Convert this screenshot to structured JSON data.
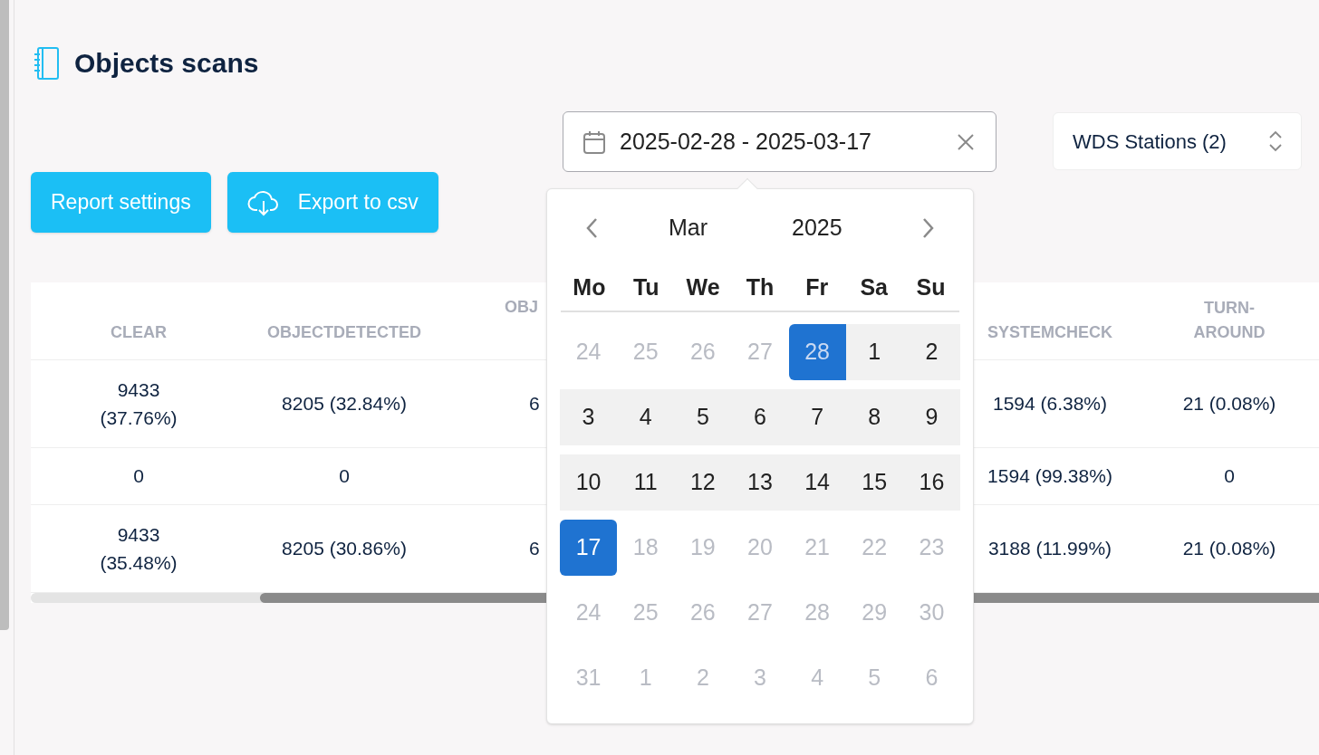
{
  "page_title": "Objects scans",
  "date_range": {
    "value": "2025-02-28 - 2025-03-17"
  },
  "station_select": {
    "value": "WDS Stations (2)"
  },
  "buttons": [
    {
      "kind": "plain",
      "label": "Report settings"
    },
    {
      "kind": "export",
      "label": "Export to csv"
    }
  ],
  "table": {
    "columns": [
      {
        "label": "CLEAR",
        "kind": "full"
      },
      {
        "label": "OBJECTDETECTED",
        "kind": "full"
      },
      {
        "label": "OBJ",
        "kind": "partial"
      },
      {
        "label": "SYSTEMCHECK",
        "kind": "full"
      },
      {
        "label": "TURN-AROUND",
        "kind": "full"
      }
    ],
    "rows": [
      [
        "9433 (37.76%)",
        "8205 (32.84%)",
        "6",
        "1594 (6.38%)",
        "21 (0.08%)"
      ],
      [
        "0",
        "0",
        "",
        "1594 (99.38%)",
        "0"
      ],
      [
        "9433 (35.48%)",
        "8205 (30.86%)",
        "6",
        "3188 (11.99%)",
        "21 (0.08%)"
      ]
    ]
  },
  "calendar": {
    "month": "Mar",
    "year": "2025",
    "weekdays": [
      "Mo",
      "Tu",
      "We",
      "Th",
      "Fr",
      "Sa",
      "Su"
    ],
    "weeks": [
      [
        {
          "label": "24",
          "muted": true,
          "selected": false,
          "in_range": false
        },
        {
          "label": "25",
          "muted": true,
          "selected": false,
          "in_range": false
        },
        {
          "label": "26",
          "muted": true,
          "selected": false,
          "in_range": false
        },
        {
          "label": "27",
          "muted": true,
          "selected": false,
          "in_range": false
        },
        {
          "label": "28",
          "muted": true,
          "selected": true,
          "in_range": true
        },
        {
          "label": "1",
          "muted": false,
          "selected": false,
          "in_range": true
        },
        {
          "label": "2",
          "muted": false,
          "selected": false,
          "in_range": true
        }
      ],
      [
        {
          "label": "3",
          "muted": false,
          "selected": false,
          "in_range": true
        },
        {
          "label": "4",
          "muted": false,
          "selected": false,
          "in_range": true
        },
        {
          "label": "5",
          "muted": false,
          "selected": false,
          "in_range": true
        },
        {
          "label": "6",
          "muted": false,
          "selected": false,
          "in_range": true
        },
        {
          "label": "7",
          "muted": false,
          "selected": false,
          "in_range": true
        },
        {
          "label": "8",
          "muted": false,
          "selected": false,
          "in_range": true
        },
        {
          "label": "9",
          "muted": false,
          "selected": false,
          "in_range": true
        }
      ],
      [
        {
          "label": "10",
          "muted": false,
          "selected": false,
          "in_range": true
        },
        {
          "label": "11",
          "muted": false,
          "selected": false,
          "in_range": true
        },
        {
          "label": "12",
          "muted": false,
          "selected": false,
          "in_range": true
        },
        {
          "label": "13",
          "muted": false,
          "selected": false,
          "in_range": true
        },
        {
          "label": "14",
          "muted": false,
          "selected": false,
          "in_range": true
        },
        {
          "label": "15",
          "muted": false,
          "selected": false,
          "in_range": true
        },
        {
          "label": "16",
          "muted": false,
          "selected": false,
          "in_range": true
        }
      ],
      [
        {
          "label": "17",
          "muted": false,
          "selected": true,
          "in_range": false
        },
        {
          "label": "18",
          "muted": true,
          "selected": false,
          "in_range": false
        },
        {
          "label": "19",
          "muted": true,
          "selected": false,
          "in_range": false
        },
        {
          "label": "20",
          "muted": true,
          "selected": false,
          "in_range": false
        },
        {
          "label": "21",
          "muted": true,
          "selected": false,
          "in_range": false
        },
        {
          "label": "22",
          "muted": true,
          "selected": false,
          "in_range": false
        },
        {
          "label": "23",
          "muted": true,
          "selected": false,
          "in_range": false
        }
      ],
      [
        {
          "label": "24",
          "muted": true,
          "selected": false,
          "in_range": false
        },
        {
          "label": "25",
          "muted": true,
          "selected": false,
          "in_range": false
        },
        {
          "label": "26",
          "muted": true,
          "selected": false,
          "in_range": false
        },
        {
          "label": "27",
          "muted": true,
          "selected": false,
          "in_range": false
        },
        {
          "label": "28",
          "muted": true,
          "selected": false,
          "in_range": false
        },
        {
          "label": "29",
          "muted": true,
          "selected": false,
          "in_range": false
        },
        {
          "label": "30",
          "muted": true,
          "selected": false,
          "in_range": false
        }
      ],
      [
        {
          "label": "31",
          "muted": true,
          "selected": false,
          "in_range": false
        },
        {
          "label": "1",
          "muted": true,
          "selected": false,
          "in_range": false
        },
        {
          "label": "2",
          "muted": true,
          "selected": false,
          "in_range": false
        },
        {
          "label": "3",
          "muted": true,
          "selected": false,
          "in_range": false
        },
        {
          "label": "4",
          "muted": true,
          "selected": false,
          "in_range": false
        },
        {
          "label": "5",
          "muted": true,
          "selected": false,
          "in_range": false
        },
        {
          "label": "6",
          "muted": true,
          "selected": false,
          "in_range": false
        }
      ]
    ]
  }
}
